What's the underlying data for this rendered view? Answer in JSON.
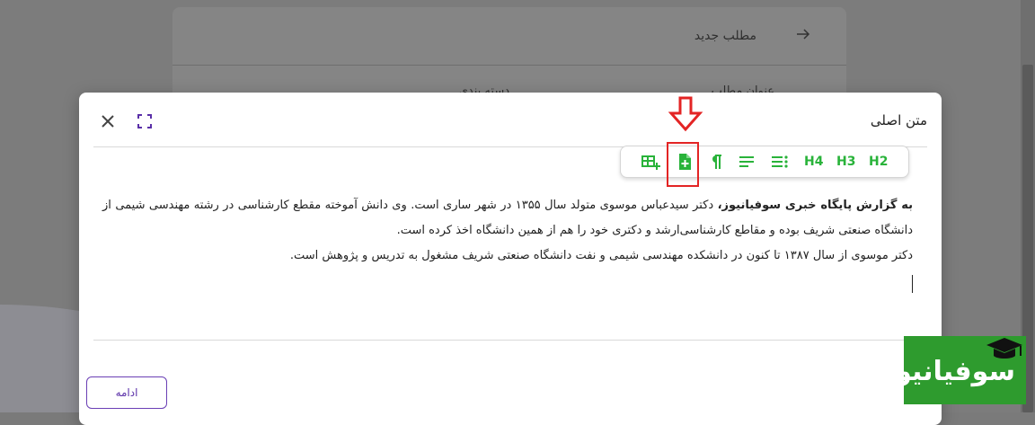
{
  "background": {
    "card_title": "مطلب جدید",
    "field_title_label": "عنوان مطلب",
    "field_category_label": "دسته بندی"
  },
  "modal": {
    "title": "متن اصلی",
    "toolbar": {
      "buttons": [
        {
          "name": "h2",
          "label": "H2"
        },
        {
          "name": "h3",
          "label": "H3"
        },
        {
          "name": "h4",
          "label": "H4"
        },
        {
          "name": "bulleted-list",
          "icon": "list-icon"
        },
        {
          "name": "align",
          "icon": "align-icon"
        },
        {
          "name": "paragraph",
          "icon": "pilcrow-icon"
        },
        {
          "name": "add-file",
          "icon": "file-plus-icon"
        },
        {
          "name": "insert-table",
          "icon": "table-plus-icon"
        }
      ]
    },
    "content": {
      "lead_bold": "به گزارش پایگاه خبری سوفیانیوز،",
      "paragraph1_rest": " دکتر سیدعباس موسوی متولد سال ۱۳۵۵ در شهر ساری است. وی دانش آموخته مقطع کارشناسی در رشته مهندسی شیمی از دانشگاه صنعتی شریف بوده و مقاطع کارشناسی‌ارشد و دکتری خود را هم از همین دانشگاه  اخذ کرده است.",
      "paragraph2": "دکتر موسوی از سال ۱۳۸۷ تا کنون در دانشکده مهندسی شیمی و نفت دانشگاه صنعتی شریف مشغول به تدریس و پژوهش است."
    },
    "continue_label": "ادامه"
  },
  "logo": {
    "text": "سوفیانیوز"
  },
  "colors": {
    "accent": "#29b33a",
    "purple": "#5a2fa8",
    "highlight": "#e32424",
    "logo_bg": "#2e9b2e"
  }
}
